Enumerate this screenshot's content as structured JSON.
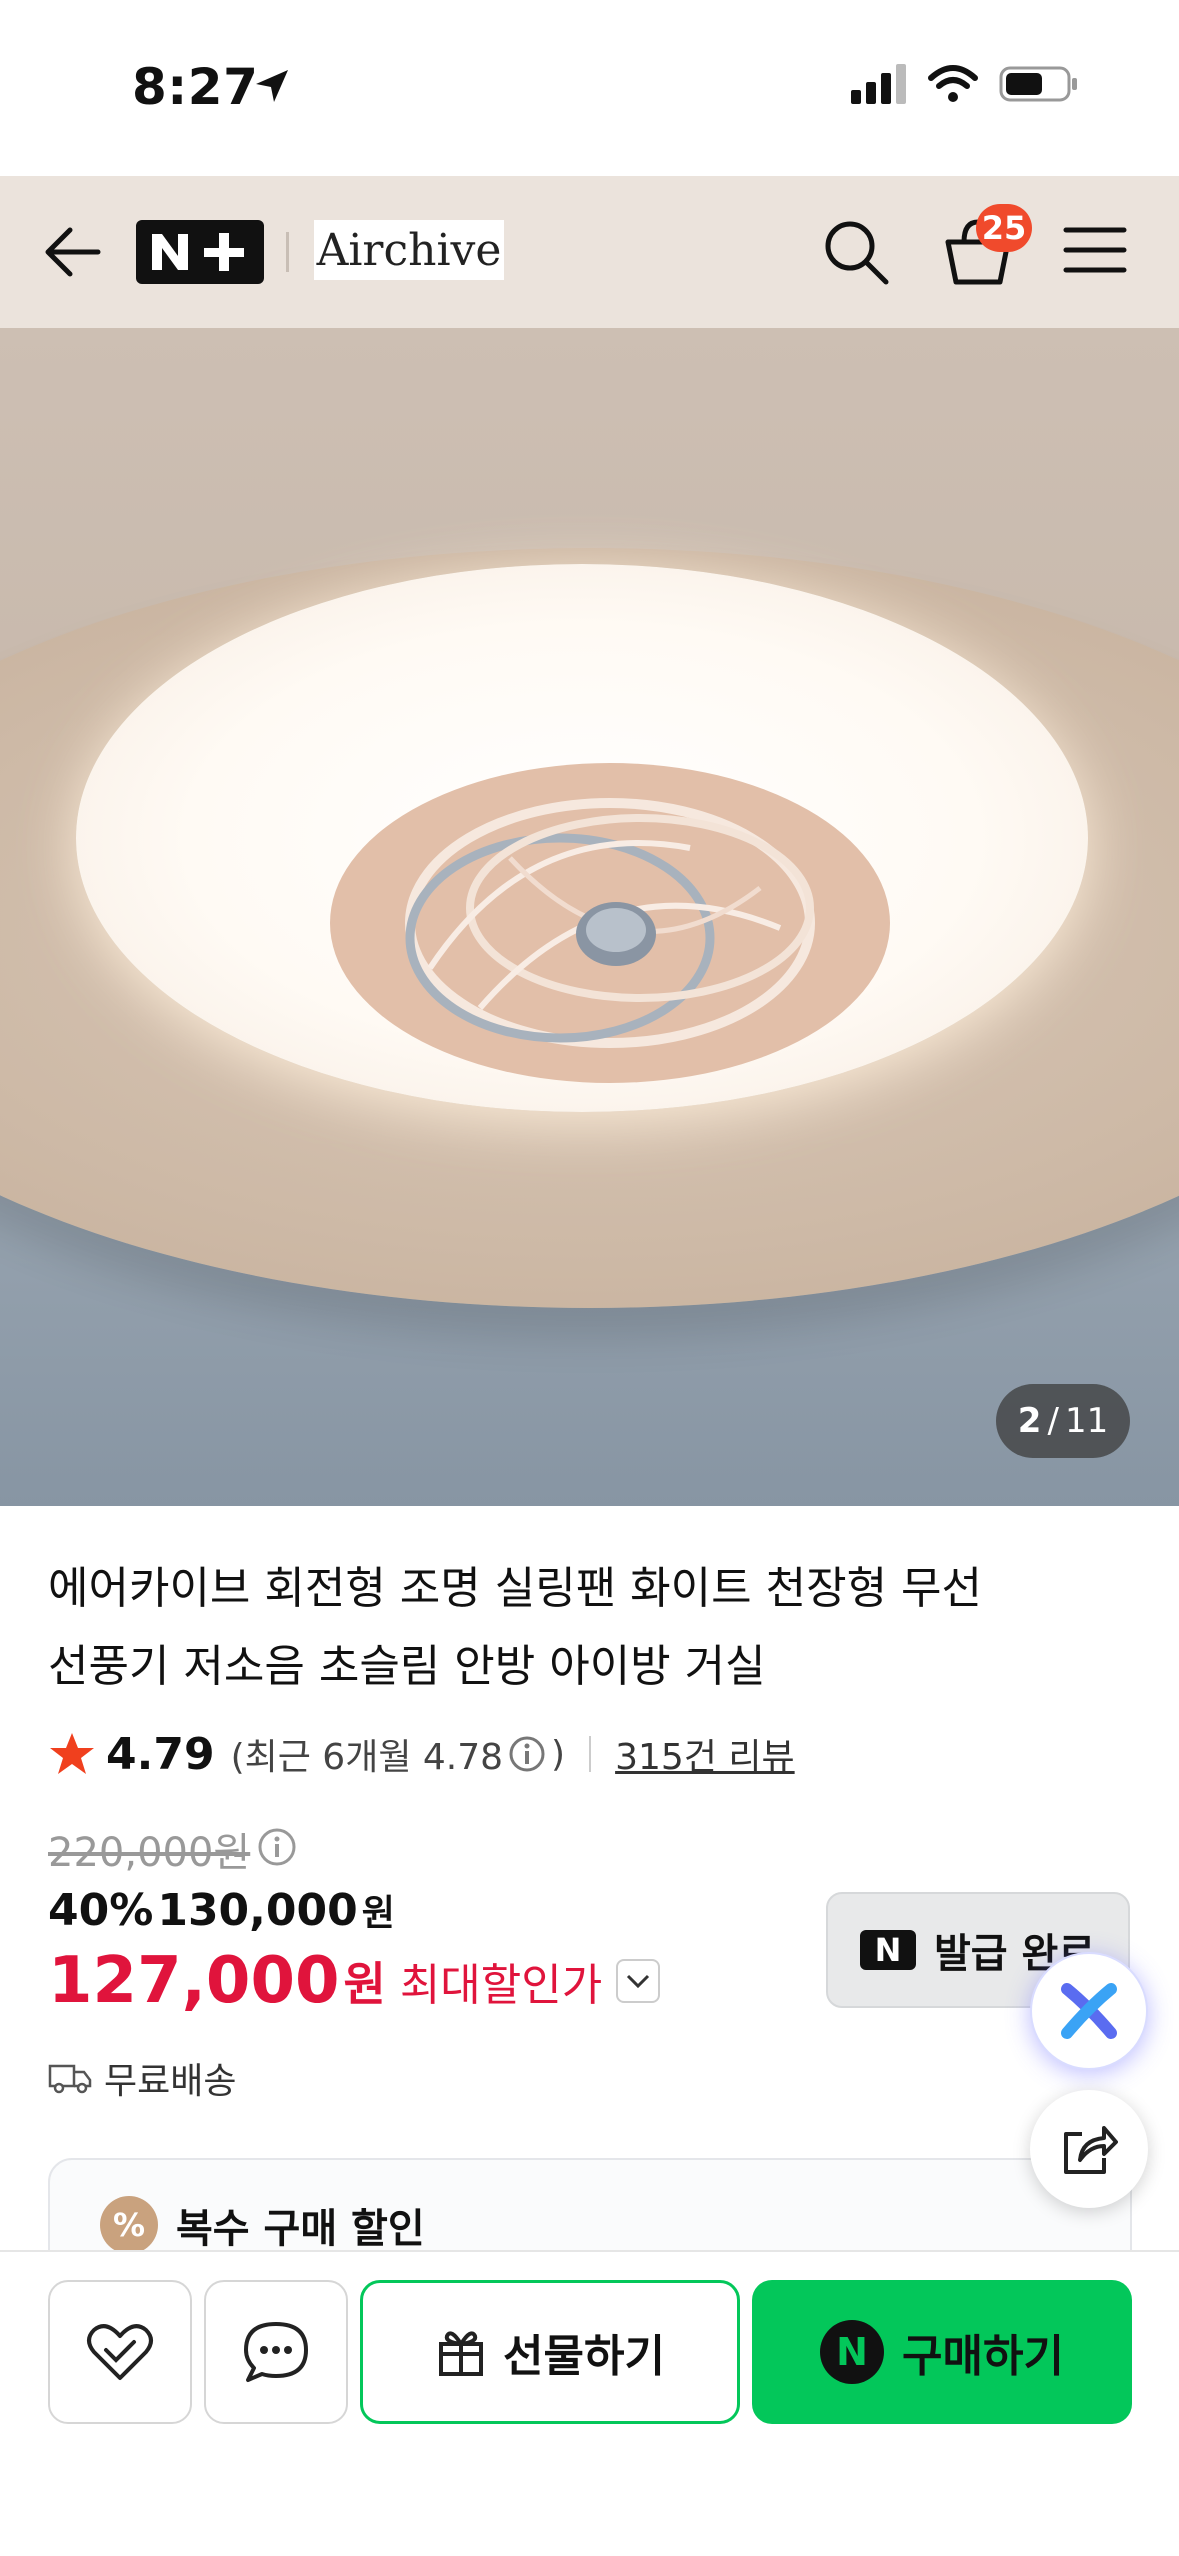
{
  "status_bar": {
    "time": "8:27"
  },
  "header": {
    "brand_logo_text": "Airchive",
    "cart_count": "25"
  },
  "gallery": {
    "current": "2",
    "separator": "/",
    "total": "11"
  },
  "product": {
    "title_line1": "에어카이브 회전형 조명 실링팬 화이트 천장형 무선",
    "title_line2": "선풍기 저소음 초슬림 안방 아이방 거실",
    "rating": "4.79",
    "rating_recent": "(최근 6개월 4.78",
    "rating_recent_close": ")",
    "review_link": "315건 리뷰",
    "original_price": "220,000원",
    "discount_pct": "40%",
    "sale_price": "130,000",
    "sale_won": "원",
    "max_price": "127,000",
    "max_won": "원",
    "max_label": "최대할인가",
    "coupon_label": "발급 완료",
    "shipping": "무료배송",
    "multi_discount_label": "복수 구매 할인"
  },
  "bottom_bar": {
    "gift_label": "선물하기",
    "buy_label": "구매하기"
  },
  "colors": {
    "accent_green": "#03c75a",
    "price_red": "#e0143c",
    "badge_red": "#f04a2c",
    "header_bg": "#ebe3dc"
  }
}
